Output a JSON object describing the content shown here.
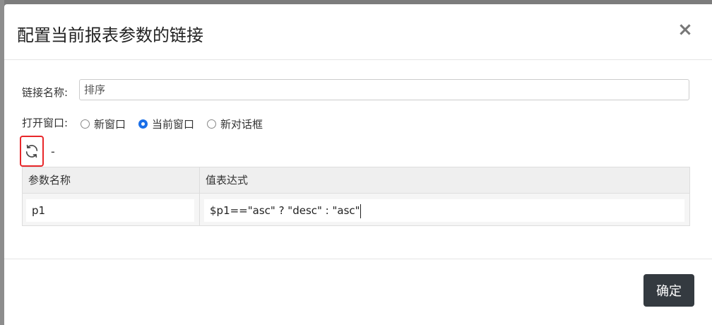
{
  "dialog": {
    "title": "配置当前报表参数的链接",
    "close_symbol": "×"
  },
  "link_name": {
    "label": "链接名称:",
    "value": "排序"
  },
  "open_window": {
    "label": "打开窗口:",
    "options": [
      {
        "label": "新窗口",
        "checked": false
      },
      {
        "label": "当前窗口",
        "checked": true
      },
      {
        "label": "新对话框",
        "checked": false
      }
    ]
  },
  "refresh": {
    "icon": "refresh-icon",
    "separator": "-"
  },
  "param_table": {
    "headers": [
      "参数名称",
      "值表达式"
    ],
    "rows": [
      {
        "name": "p1",
        "expression": "$p1==\"asc\" ? \"desc\" : \"asc\""
      }
    ]
  },
  "footer": {
    "confirm_label": "确定"
  }
}
